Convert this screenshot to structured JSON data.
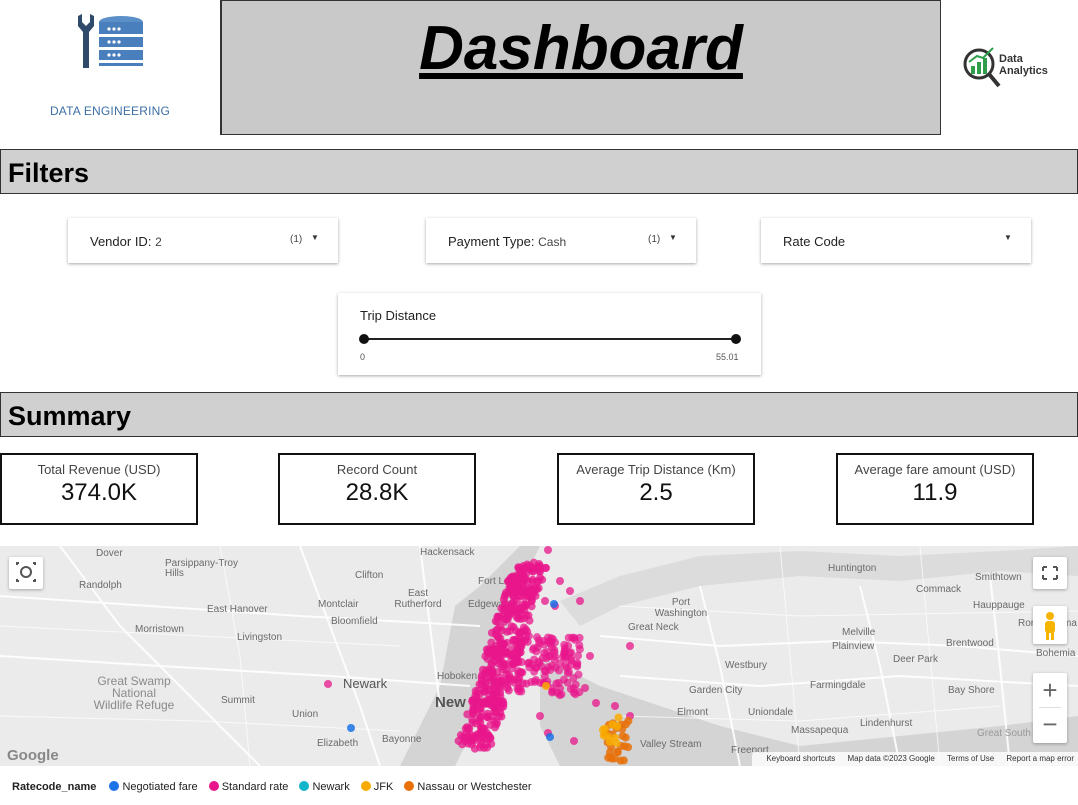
{
  "header": {
    "left_logo_caption": "DATA ENGINEERING",
    "title": "Dashboard",
    "right_logo_line1": "Data",
    "right_logo_line2": "Analytics"
  },
  "sections": {
    "filters": "Filters",
    "summary": "Summary"
  },
  "filters": {
    "vendor": {
      "label": "Vendor ID",
      "value": "2",
      "count": "(1)"
    },
    "payment": {
      "label": "Payment Type",
      "value": "Cash",
      "count": "(1)"
    },
    "rate_code": {
      "label": "Rate Code"
    },
    "trip_distance": {
      "label": "Trip Distance",
      "min": "0",
      "max": "55.01"
    }
  },
  "kpis": [
    {
      "label": "Total Revenue (USD)",
      "value": "374.0K"
    },
    {
      "label": "Record Count",
      "value": "28.8K"
    },
    {
      "label": "Average Trip Distance (Km)",
      "value": "2.5"
    },
    {
      "label": "Average fare amount (USD)",
      "value": "11.9"
    }
  ],
  "map": {
    "places": [
      "Dover",
      "Parsippany-Troy Hills",
      "Randolph",
      "Hackensack",
      "Clifton",
      "East Rutherford",
      "Fort Lee",
      "Edgewater",
      "Huntington",
      "Commack",
      "Smithtown",
      "Hauppauge",
      "Ronkonkoma",
      "Bohemia",
      "East Hanover",
      "Montclair",
      "Bloomfield",
      "Port Washington",
      "Great Neck",
      "Morristown",
      "Livingston",
      "Melville",
      "Brentwood",
      "Plainview",
      "Deer Park",
      "Westbury",
      "Newark",
      "Hoboken",
      "New York",
      "Farmingdale",
      "Garden City",
      "Bay Shore",
      "Great Swamp National Wildlife Refuge",
      "Summit",
      "Union",
      "Elizabeth",
      "Bayonne",
      "Elmont",
      "Uniondale",
      "Lindenhurst",
      "Massapequa",
      "Valley Stream",
      "Freeport",
      "Great South Bay"
    ],
    "attribution": [
      "Keyboard shortcuts",
      "Map data ©2023 Google",
      "Terms of Use",
      "Report a map error"
    ],
    "google": "Google",
    "zoom_in": "+",
    "zoom_out": "−"
  },
  "legend": {
    "title": "Ratecode_name",
    "items": [
      {
        "name": "Negotiated fare",
        "color": "#1a73e8"
      },
      {
        "name": "Standard rate",
        "color": "#e8168b"
      },
      {
        "name": "Newark",
        "color": "#12b5cb"
      },
      {
        "name": "JFK",
        "color": "#f9ab00"
      },
      {
        "name": "Nassau or Westchester",
        "color": "#e8710a"
      }
    ]
  }
}
